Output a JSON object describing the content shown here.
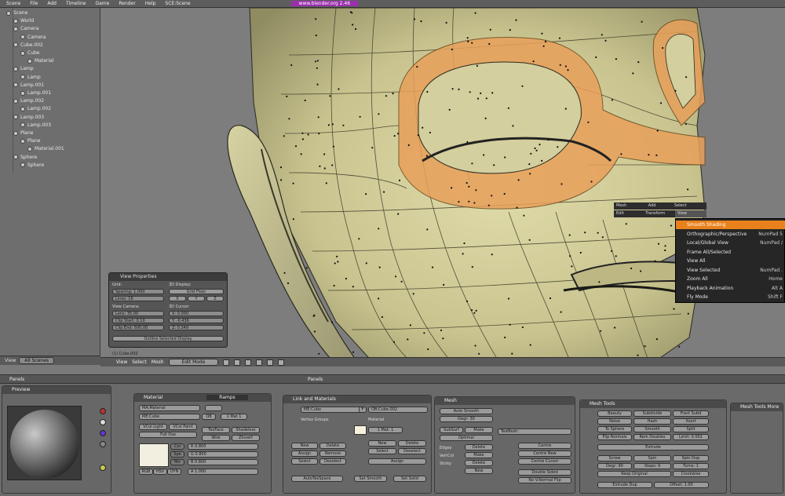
{
  "topbar": {
    "items": [
      "Scene",
      "File",
      "Add",
      "Timeline",
      "Game",
      "Render",
      "Help"
    ],
    "scene_label": "SCE:Scene",
    "highlight": "www.blender.org 2.46"
  },
  "outliner": {
    "items": [
      {
        "label": "Scene",
        "depth": 0
      },
      {
        "label": "World",
        "depth": 1
      },
      {
        "label": "Camera",
        "depth": 1
      },
      {
        "label": "Camera",
        "depth": 2
      },
      {
        "label": "Cube.002",
        "depth": 1
      },
      {
        "label": "Cube",
        "depth": 2
      },
      {
        "label": "Material",
        "depth": 3
      },
      {
        "label": "Lamp",
        "depth": 1
      },
      {
        "label": "Lamp",
        "depth": 2
      },
      {
        "label": "Lamp.001",
        "depth": 1
      },
      {
        "label": "Lamp.001",
        "depth": 2
      },
      {
        "label": "Lamp.002",
        "depth": 1
      },
      {
        "label": "Lamp.002",
        "depth": 2
      },
      {
        "label": "Lamp.003",
        "depth": 1
      },
      {
        "label": "Lamp.003",
        "depth": 2
      },
      {
        "label": "Plane",
        "depth": 1
      },
      {
        "label": "Plane",
        "depth": 2
      },
      {
        "label": "Material.001",
        "depth": 3
      },
      {
        "label": "Sphere",
        "depth": 1
      },
      {
        "label": "Sphere",
        "depth": 2
      }
    ],
    "footer_view": "View",
    "footer_select": "All Scenes"
  },
  "view_properties": {
    "title": "View Properties",
    "grid_label": "Grid:",
    "spacing": "Spacing: 1.000",
    "lines": "Lines: 16",
    "view_camera": "View Camera:",
    "lens": "Lens: 35.00",
    "clip_start": "Clip Start: 0.10",
    "clip_end": "Clip End: 500.00",
    "view_3d_cursor": "3D Display:",
    "grid_floor": "Grid Floor",
    "x": "X",
    "y": "Y",
    "z": "Z",
    "cursor_label": "3D Cursor:",
    "cx": "X: 0.000",
    "cy": "Y: -0.436",
    "cz": "Z: 0.349",
    "lock_btn": "Outline Selected Display",
    "object_label": "(1) Cube.002"
  },
  "viewport_header": {
    "view": "View",
    "select": "Select",
    "mesh": "Mesh",
    "mode": "Edit Mode"
  },
  "context_menu": {
    "bar_items": [
      "Mesh",
      "Add",
      "Select",
      "Edit",
      "Transform",
      "View"
    ],
    "items": [
      {
        "label": "Smooth Shading",
        "key": "",
        "active": true
      },
      {
        "label": "Orthographic/Perspective",
        "key": "NumPad 5",
        "active": false
      },
      {
        "label": "Local/Global View",
        "key": "NumPad /",
        "active": false
      },
      {
        "label": "Frame All/Selected",
        "key": "",
        "active": false
      },
      {
        "label": "View All",
        "key": "",
        "active": false
      },
      {
        "label": "View Selected",
        "key": "NumPad .",
        "active": false
      },
      {
        "label": "Zoom All",
        "key": "Home",
        "active": false
      },
      {
        "label": "Playback Animation",
        "key": "Alt A",
        "active": false
      },
      {
        "label": "Fly Mode",
        "key": "Shift F",
        "active": false
      }
    ]
  },
  "bottom": {
    "header_panels": "Panels",
    "preview": {
      "title": "Preview"
    },
    "material": {
      "tab1": "Material",
      "tab2": "Ramps",
      "ma_name": "MA:Material",
      "me_name": "ME:Cube",
      "ob": "OB",
      "mat_count": "1 Mat 1",
      "vcol_light": "VCol Light",
      "vcol_paint": "VCol Paint",
      "tex_face": "TexFace",
      "shadeless": "Shadeless",
      "no_mist": "No Mist",
      "env": "Env",
      "full_osa": "Full Osa",
      "wire": "Wire",
      "zinvert": "ZInvert",
      "col": "Col",
      "spe": "Spe",
      "mir": "Mir",
      "r": "R 0.800",
      "g": "G 0.800",
      "bb": "B 0.800",
      "a": "A 1.000",
      "rgb": "RGB",
      "hsv": "HSV",
      "dyn": "DYN"
    },
    "link": {
      "title": "Link and Materials",
      "me": "ME:Cube",
      "f": "F",
      "ob": "OB:Cube.002",
      "vertex_groups": "Vertex Groups",
      "material": "Material",
      "mat": "1 Mat: 1",
      "new": "New",
      "delete": "Delete",
      "copy_group": "Copy Group",
      "assign": "Assign",
      "remove": "Remove",
      "select": "Select",
      "deselect": "Deselect",
      "autotexspace": "AutoTexSpace",
      "set_smooth": "Set Smooth",
      "set_solid": "Set Solid"
    },
    "mesh": {
      "title": "Mesh",
      "auto_smooth": "Auto Smooth",
      "degr": "Degr: 30",
      "sticky": "Sticky",
      "make": "Make",
      "uv_tex": "UV Texture",
      "new": "New",
      "vertcol": "VertCol",
      "texmesh": "TexMesh:",
      "centre": "Centre",
      "centre_new": "Centre New",
      "centre_cursor": "Centre Cursor",
      "double_sided": "Double Sided",
      "no_vnormal_flip": "No V.Normal Flip",
      "delete": "Delete",
      "edges": "Edges",
      "subsurf": "SubSurf",
      "optimal": "Optimal"
    },
    "mesh_tools": {
      "title": "Mesh Tools",
      "beauty": "Beauty",
      "short": "Short",
      "subdivide": "Subdivide",
      "fract_subd": "Fract Subd",
      "noise": "Noise",
      "hash": "Hash",
      "xsort": "Xsort",
      "to_sphere": "To Sphere",
      "smooth": "Smooth",
      "split": "Split",
      "flip_normals": "Flip Normals",
      "rem_doubles": "Rem Doubles",
      "limit": "Limit: 0.001",
      "extrude": "Extrude",
      "screw": "Screw",
      "spin": "Spin",
      "spin_dup": "Spin Dup",
      "degr": "Degr: 90",
      "steps": "Steps: 9",
      "turns": "Turns: 1",
      "keep_original": "Keep Original",
      "clockwise": "Clockwise",
      "extrude_dup": "Extrude Dup",
      "offset": "Offset: 1.00"
    },
    "mesh_tools_more": {
      "title": "Mesh Tools More"
    }
  },
  "colors": {
    "face": "#dcd9a8",
    "face_shadow": "#8f8c62",
    "selected": "#e8a05a",
    "accent": "#e8801c",
    "highlight_bar": "#9b2fae"
  }
}
